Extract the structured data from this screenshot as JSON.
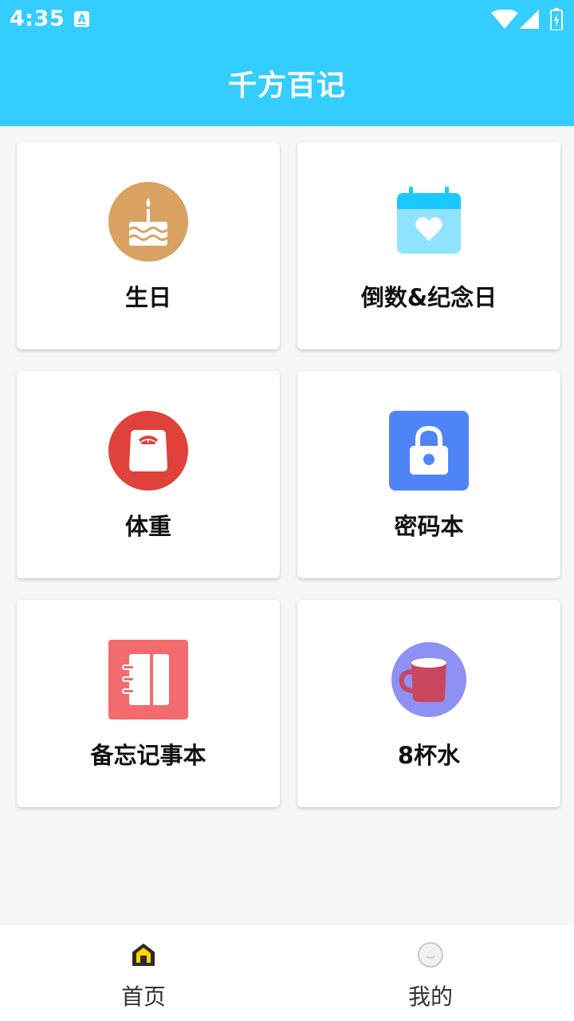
{
  "status_bar": {
    "time": "4:35",
    "icons": [
      "notification-a-icon",
      "wifi-icon",
      "signal-icon",
      "battery-charging-icon"
    ]
  },
  "header": {
    "title": "千方百记"
  },
  "cards": [
    {
      "label": "生日",
      "icon": "birthday-cake-icon"
    },
    {
      "label": "倒数&纪念日",
      "icon": "calendar-heart-icon"
    },
    {
      "label": "体重",
      "icon": "weight-scale-icon"
    },
    {
      "label": "密码本",
      "icon": "padlock-icon"
    },
    {
      "label": "备忘记事本",
      "icon": "notebook-icon"
    },
    {
      "label": "8杯水",
      "icon": "water-cup-icon"
    }
  ],
  "bottom_nav": {
    "home": {
      "label": "首页",
      "icon": "home-icon"
    },
    "me": {
      "label": "我的",
      "icon": "profile-face-icon"
    }
  },
  "colors": {
    "header": "#34cdff",
    "background": "#f6f7f9",
    "birthday": "#d9a262",
    "calendar": "#19c9ff",
    "weight": "#e0413a",
    "password": "#4f85f7",
    "notebook": "#f36b6e",
    "water": "#8e90f4"
  }
}
